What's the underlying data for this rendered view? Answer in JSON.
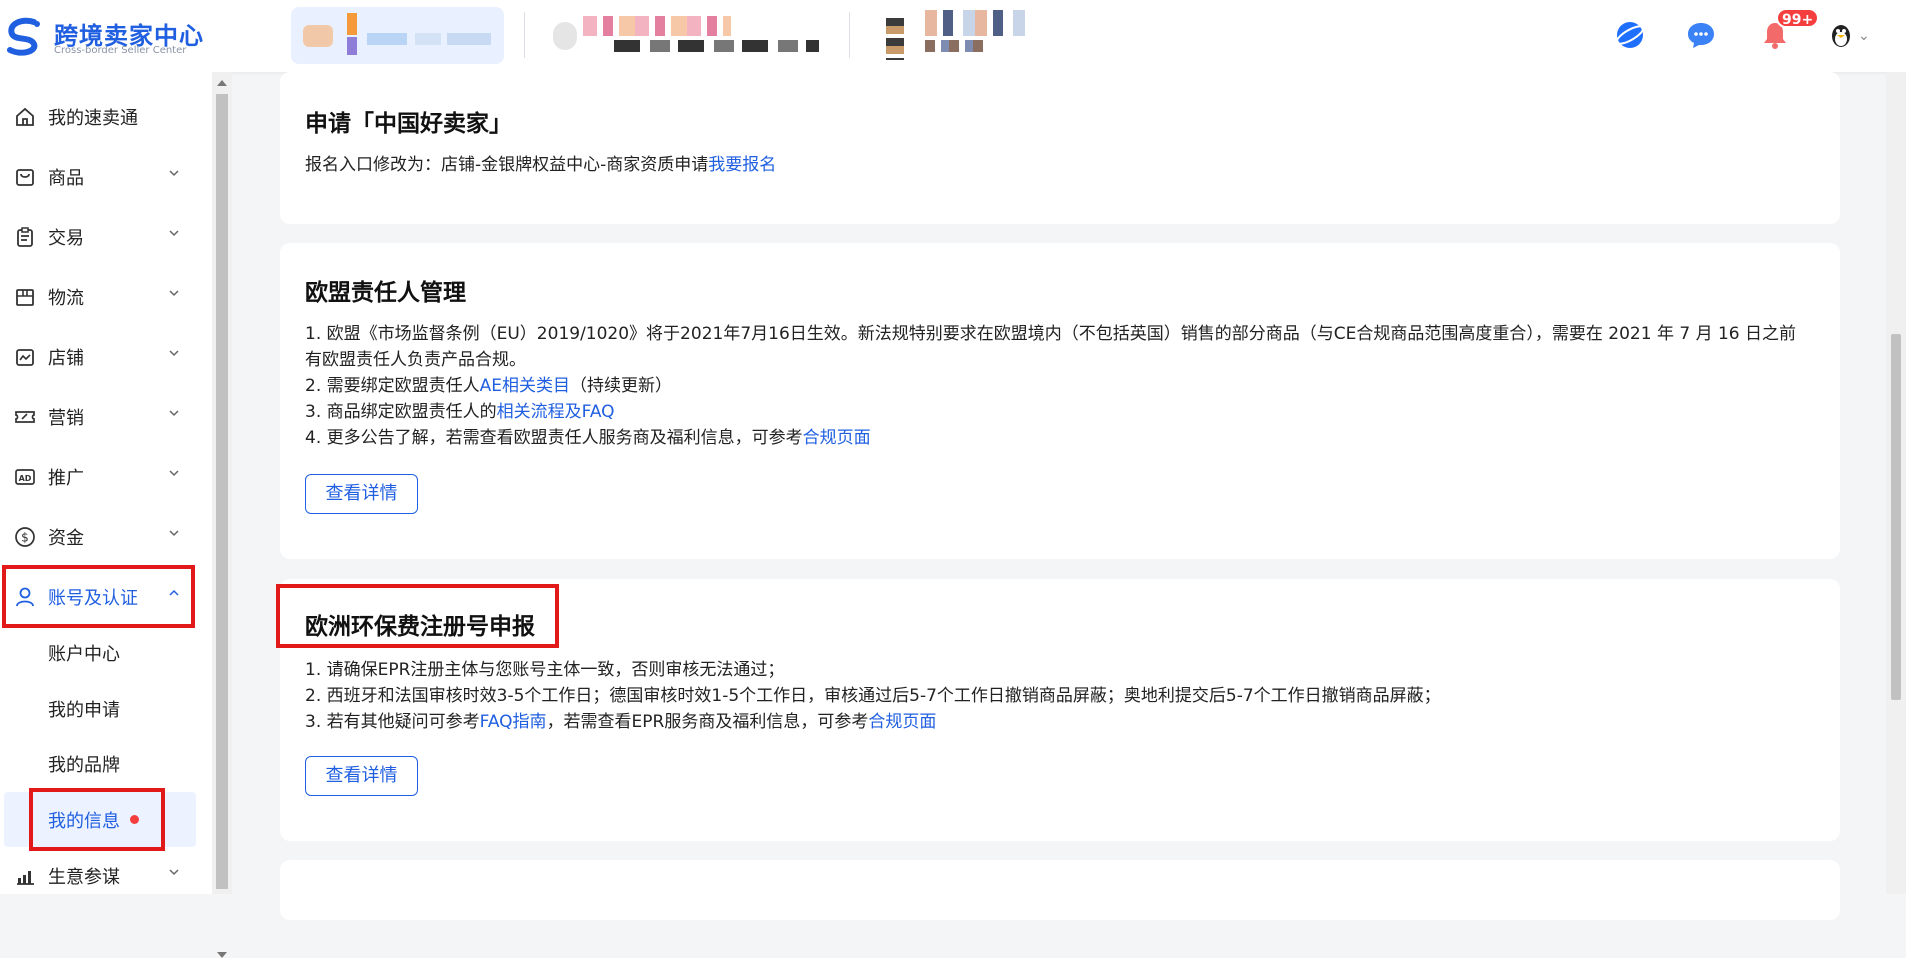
{
  "header": {
    "logo_title": "跨境卖家中心",
    "logo_subtitle": "Cross-border Seller Center",
    "notification_count": "99+",
    "colors": {
      "brand": "#1f5fe0",
      "badge": "#f53f3f"
    }
  },
  "sidebar": {
    "items": [
      {
        "label": "我的速卖通",
        "icon": "home-icon"
      },
      {
        "label": "商品",
        "icon": "bag-icon"
      },
      {
        "label": "交易",
        "icon": "clipboard-icon"
      },
      {
        "label": "物流",
        "icon": "box-icon"
      },
      {
        "label": "店铺",
        "icon": "shop-icon"
      },
      {
        "label": "营销",
        "icon": "ticket-icon"
      },
      {
        "label": "推广",
        "icon": "ad-icon"
      },
      {
        "label": "资金",
        "icon": "dollar-icon"
      },
      {
        "label": "账号及认证",
        "icon": "user-icon"
      },
      {
        "label": "生意参谋",
        "icon": "chart-icon"
      }
    ],
    "subitems": [
      {
        "label": "账户中心"
      },
      {
        "label": "我的申请"
      },
      {
        "label": "我的品牌"
      },
      {
        "label": "我的信息"
      }
    ]
  },
  "cards": {
    "c1": {
      "title": "申请「中国好卖家」",
      "line1_text": "报名入口修改为：店铺-金银牌权益中心-商家资质申请",
      "line1_link": "我要报名"
    },
    "c2": {
      "title": "欧盟责任人管理",
      "l1": "1. 欧盟《市场监督条例（EU）2019/1020》将于2021年7月16日生效。新法规特别要求在欧盟境内（不包括英国）销售的部分商品（与CE合规商品范围高度重合），需要在 2021 年 7 月 16 日之前",
      "l1b": "有欧盟责任人负责产品合规。",
      "l2_pre": "2. 需要绑定欧盟责任人",
      "l2_link": "AE相关类目",
      "l2_post": "（持续更新）",
      "l3_pre": "3. 商品绑定欧盟责任人的",
      "l3_link": "相关流程及FAQ",
      "l4_pre": "4. 更多公告了解，若需查看欧盟责任人服务商及福利信息，可参考",
      "l4_link": "合规页面",
      "button": "查看详情"
    },
    "c3": {
      "title": "欧洲环保费注册号申报",
      "l1": "1. 请确保EPR注册主体与您账号主体一致，否则审核无法通过；",
      "l2": "2. 西班牙和法国审核时效3-5个工作日；德国审核时效1-5个工作日，审核通过后5-7个工作日撤销商品屏蔽；奥地利提交后5-7个工作日撤销商品屏蔽；",
      "l3_pre": "3. 若有其他疑问可参考",
      "l3_link1": "FAQ指南",
      "l3_mid": "，若需查看EPR服务商及福利信息，可参考",
      "l3_link2": "合规页面",
      "button": "查看详情"
    }
  }
}
